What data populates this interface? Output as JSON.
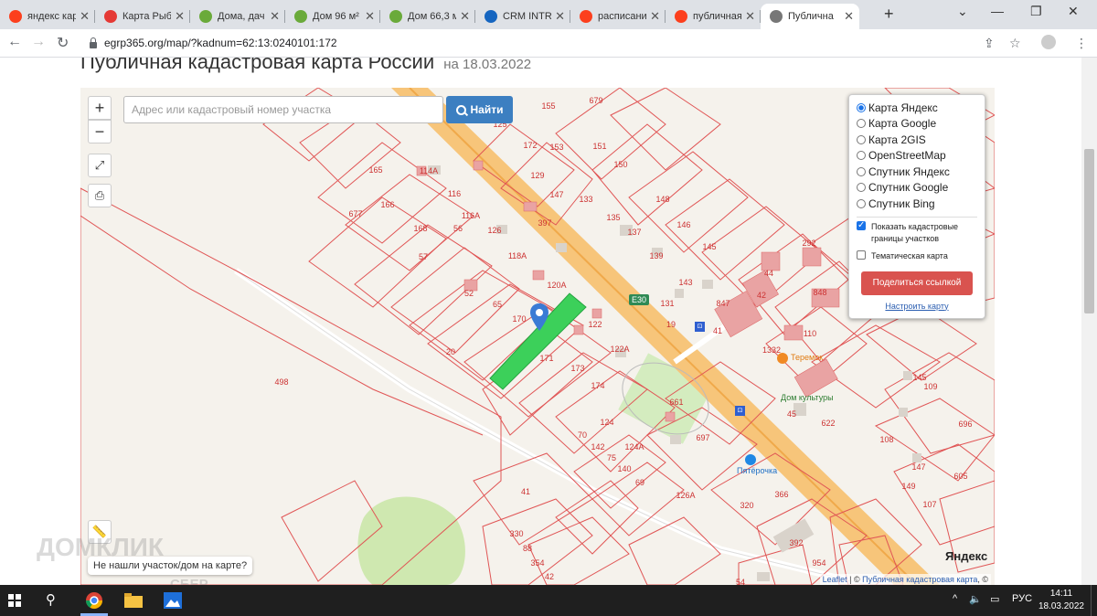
{
  "browser": {
    "tabs": [
      {
        "title": "яндекс кар",
        "favicon": "yandex-icon",
        "color": "#fc3f1d"
      },
      {
        "title": "Карта Рыб",
        "favicon": "maps-pin-icon",
        "color": "#e53935"
      },
      {
        "title": "Дома, дач",
        "favicon": "domclick-icon",
        "color": "#6aaa3a"
      },
      {
        "title": "Дом 96 м²",
        "favicon": "domclick-icon",
        "color": "#6aaa3a"
      },
      {
        "title": "Дом 66,3 м",
        "favicon": "domclick-icon",
        "color": "#6aaa3a"
      },
      {
        "title": "CRM INTR",
        "favicon": "crm-icon",
        "color": "#1565c0"
      },
      {
        "title": "расписани",
        "favicon": "yandex-icon",
        "color": "#fc3f1d"
      },
      {
        "title": "публичная",
        "favicon": "yandex-icon",
        "color": "#fc3f1d"
      },
      {
        "title": "Публична",
        "favicon": "document-icon",
        "color": "#777777",
        "active": true
      }
    ],
    "new_tab": "+",
    "url": "egrp365.org/map/?kadnum=62:13:0240101:172"
  },
  "page": {
    "title": "Публичная кадастровая карта России",
    "date": "на 18.03.2022"
  },
  "map": {
    "zoom_in": "+",
    "zoom_out": "−",
    "search_placeholder": "Адрес или кадастровый номер участка",
    "find_label": "Найти",
    "layers": [
      {
        "label": "Карта Яндекс",
        "selected": true
      },
      {
        "label": "Карта Google",
        "selected": false
      },
      {
        "label": "Карта 2GIS",
        "selected": false
      },
      {
        "label": "OpenStreetMap",
        "selected": false
      },
      {
        "label": "Спутник Яндекс",
        "selected": false
      },
      {
        "label": "Спутник Google",
        "selected": false
      },
      {
        "label": "Спутник Bing",
        "selected": false
      }
    ],
    "show_borders": {
      "label": "Показать кадастровые границы участков",
      "checked": true
    },
    "thematic": {
      "label": "Тематическая карта",
      "checked": false
    },
    "share_label": "Поделиться ссылкой",
    "setup_label": "Настроить карту",
    "not_found_label": "Не нашли участок/дом на карте?",
    "attribution": {
      "leaflet": "Leaflet",
      "sep": "| ©",
      "pkk": "Публичная кадастровая карта",
      "tail": ", ©"
    },
    "road_label": "E30",
    "yandex_logo": "Яндекс",
    "pois": [
      {
        "name": "Теремок",
        "color": "#f08a24"
      },
      {
        "name": "Дом культуры",
        "color": "#2e7d32"
      },
      {
        "name": "Пятёрочка",
        "color": "#1e88e5"
      }
    ],
    "parcel_labels": [
      "155",
      "679",
      "153",
      "151",
      "150",
      "148",
      "146",
      "145",
      "292",
      "165",
      "114А",
      "116",
      "166",
      "677",
      "168",
      "116А",
      "56",
      "126",
      "397",
      "125",
      "133",
      "135",
      "137",
      "139",
      "143",
      "57",
      "118А",
      "120А",
      "52",
      "65",
      "170",
      "122",
      "122А",
      "171",
      "173",
      "174",
      "20",
      "498",
      "661",
      "697",
      "124",
      "70",
      "142",
      "75",
      "124А",
      "140",
      "69",
      "126А",
      "41",
      "330",
      "88",
      "354",
      "42",
      "320",
      "366",
      "392",
      "954",
      "54",
      "110",
      "145",
      "109",
      "696",
      "108",
      "147",
      "149",
      "107",
      "605",
      "45",
      "44",
      "42",
      "1332",
      "622",
      "848",
      "847",
      "41",
      "19",
      "131",
      "129",
      "147",
      "172"
    ]
  },
  "taskbar": {
    "lang": "РУС",
    "time": "14:11",
    "date": "18.03.2022"
  },
  "watermark": {
    "main": "ДОМКЛИК",
    "sub": "СБЕР"
  }
}
